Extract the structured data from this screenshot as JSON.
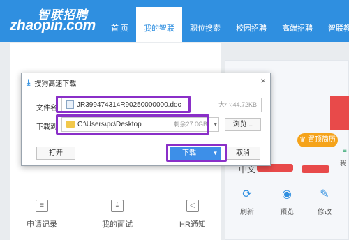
{
  "logo": {
    "cn": "智联招聘",
    "en": "zhaopin.com"
  },
  "nav": [
    "首 页",
    "我的智联",
    "职位搜索",
    "校园招聘",
    "高端招聘",
    "智联教育"
  ],
  "dialog": {
    "title": "搜狗高速下载",
    "close": "×",
    "filename_label": "文件名",
    "filename": "JR399474314R90250000000.doc",
    "size": "大小:44.72KB",
    "saveto_label": "下载到",
    "path": "C:\\Users\\pc\\Desktop",
    "free": "剩余27.0GB",
    "browse": "浏览...",
    "open": "打开",
    "download": "下载",
    "cancel": "取消"
  },
  "card": {
    "top_btn": "置顶简历",
    "lang": "中文",
    "small": "我"
  },
  "actions": [
    "刷新",
    "预览",
    "修改"
  ],
  "bottom": [
    "申请记录",
    "我的面试",
    "HR通知"
  ],
  "accent": "#2f8fe0",
  "highlight": "#8a2fc8"
}
